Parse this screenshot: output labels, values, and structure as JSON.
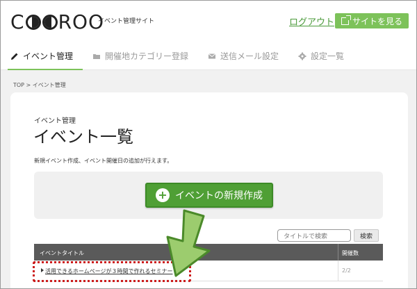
{
  "header": {
    "logo_left": "C",
    "logo_right": "ROO",
    "subtitle": "イベント管理サイト",
    "logout": "ログアウト",
    "site_button": "サイトを見る"
  },
  "nav": {
    "items": [
      {
        "label": "イベント管理",
        "icon": "pencil-icon",
        "active": true
      },
      {
        "label": "開催地カテゴリー登録",
        "icon": "folder-icon",
        "active": false
      },
      {
        "label": "送信メール設定",
        "icon": "mail-icon",
        "active": false
      },
      {
        "label": "設定一覧",
        "icon": "gear-icon",
        "active": false
      }
    ]
  },
  "breadcrumb": "TOP > イベント管理",
  "main": {
    "subheading": "イベント管理",
    "title": "イベント一覧",
    "description": "新規イベント作成、イベント開催日の追加が行えます。",
    "create_button": "イベントの新規作成",
    "search": {
      "placeholder": "タイトルで検索",
      "button": "検索"
    },
    "table": {
      "headers": [
        "イベントタイトル",
        "開催数"
      ],
      "rows": [
        {
          "title": "活用できるホームページが３時間で作れるセミナー",
          "count": "2/2"
        }
      ]
    }
  },
  "colors": {
    "accent": "#7dc25a",
    "primary_button": "#4f9f35",
    "highlight": "#cc1b1b"
  }
}
